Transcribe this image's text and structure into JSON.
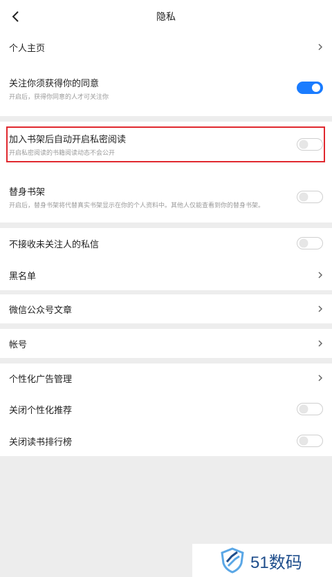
{
  "header": {
    "title": "隐私"
  },
  "profile": {
    "label": "个人主页"
  },
  "follow_consent": {
    "title": "关注你须获得你的同意",
    "subtitle": "开启后，获得你同意的人才可关注你",
    "enabled": true
  },
  "private_reading": {
    "title": "加入书架后自动开启私密阅读",
    "subtitle": "开启私密阅读的书籍阅读动态不会公开",
    "enabled": false
  },
  "substitute_shelf": {
    "title": "替身书架",
    "subtitle": "开启后，替身书架将代替真实书架显示在你的个人资料中。其他人仅能查看到你的替身书架。",
    "enabled": false
  },
  "messages": {
    "no_stranger_messages": "不接收未关注人的私信",
    "no_stranger_messages_enabled": false,
    "blacklist": "黑名单"
  },
  "wechat": {
    "label": "微信公众号文章"
  },
  "account": {
    "label": "帐号"
  },
  "ads": {
    "ad_management": "个性化广告管理",
    "close_personalized": "关闭个性化推荐",
    "close_personalized_enabled": false,
    "close_ranking": "关闭读书排行榜",
    "close_ranking_enabled": false
  },
  "watermark": {
    "text": "51数码",
    "brand_color": "#1f4e8c"
  },
  "colors": {
    "accent": "#1a7cff",
    "highlight": "#e0282e",
    "background": "#ededed"
  }
}
